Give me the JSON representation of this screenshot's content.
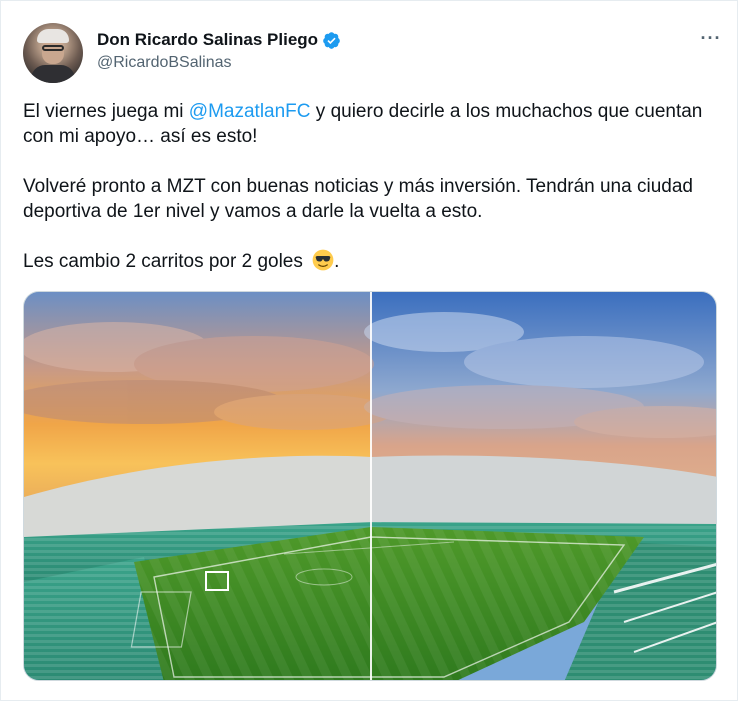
{
  "tweet": {
    "author": {
      "display_name": "Don Ricardo Salinas Pliego",
      "handle": "@RicardoBSalinas",
      "verified_icon": "verified-badge-icon",
      "avatar_icon": "avatar"
    },
    "more_label": "···",
    "text": {
      "p1_before": "El viernes juega mi ",
      "p1_mention": "@MazatlanFC",
      "p1_after": " y quiero decirle a los muchachos que cuentan con mi apoyo… así es esto!",
      "p2": "Volveré pronto a MZT con buenas noticias y más inversión. Tendrán una ciudad deportiva de 1er nivel y vamos a darle la vuelta a esto.",
      "p3_before": "Les cambio 2 carritos por 2 goles ",
      "p3_emoji": "smiling-face-with-sunglasses",
      "p3_after": "."
    },
    "media": {
      "description_icon": "stadium-photo"
    }
  },
  "colors": {
    "text": "#0f1419",
    "secondary": "#536471",
    "link": "#1d9bf0",
    "verified": "#1d9bf0",
    "border": "#cfd9de"
  }
}
